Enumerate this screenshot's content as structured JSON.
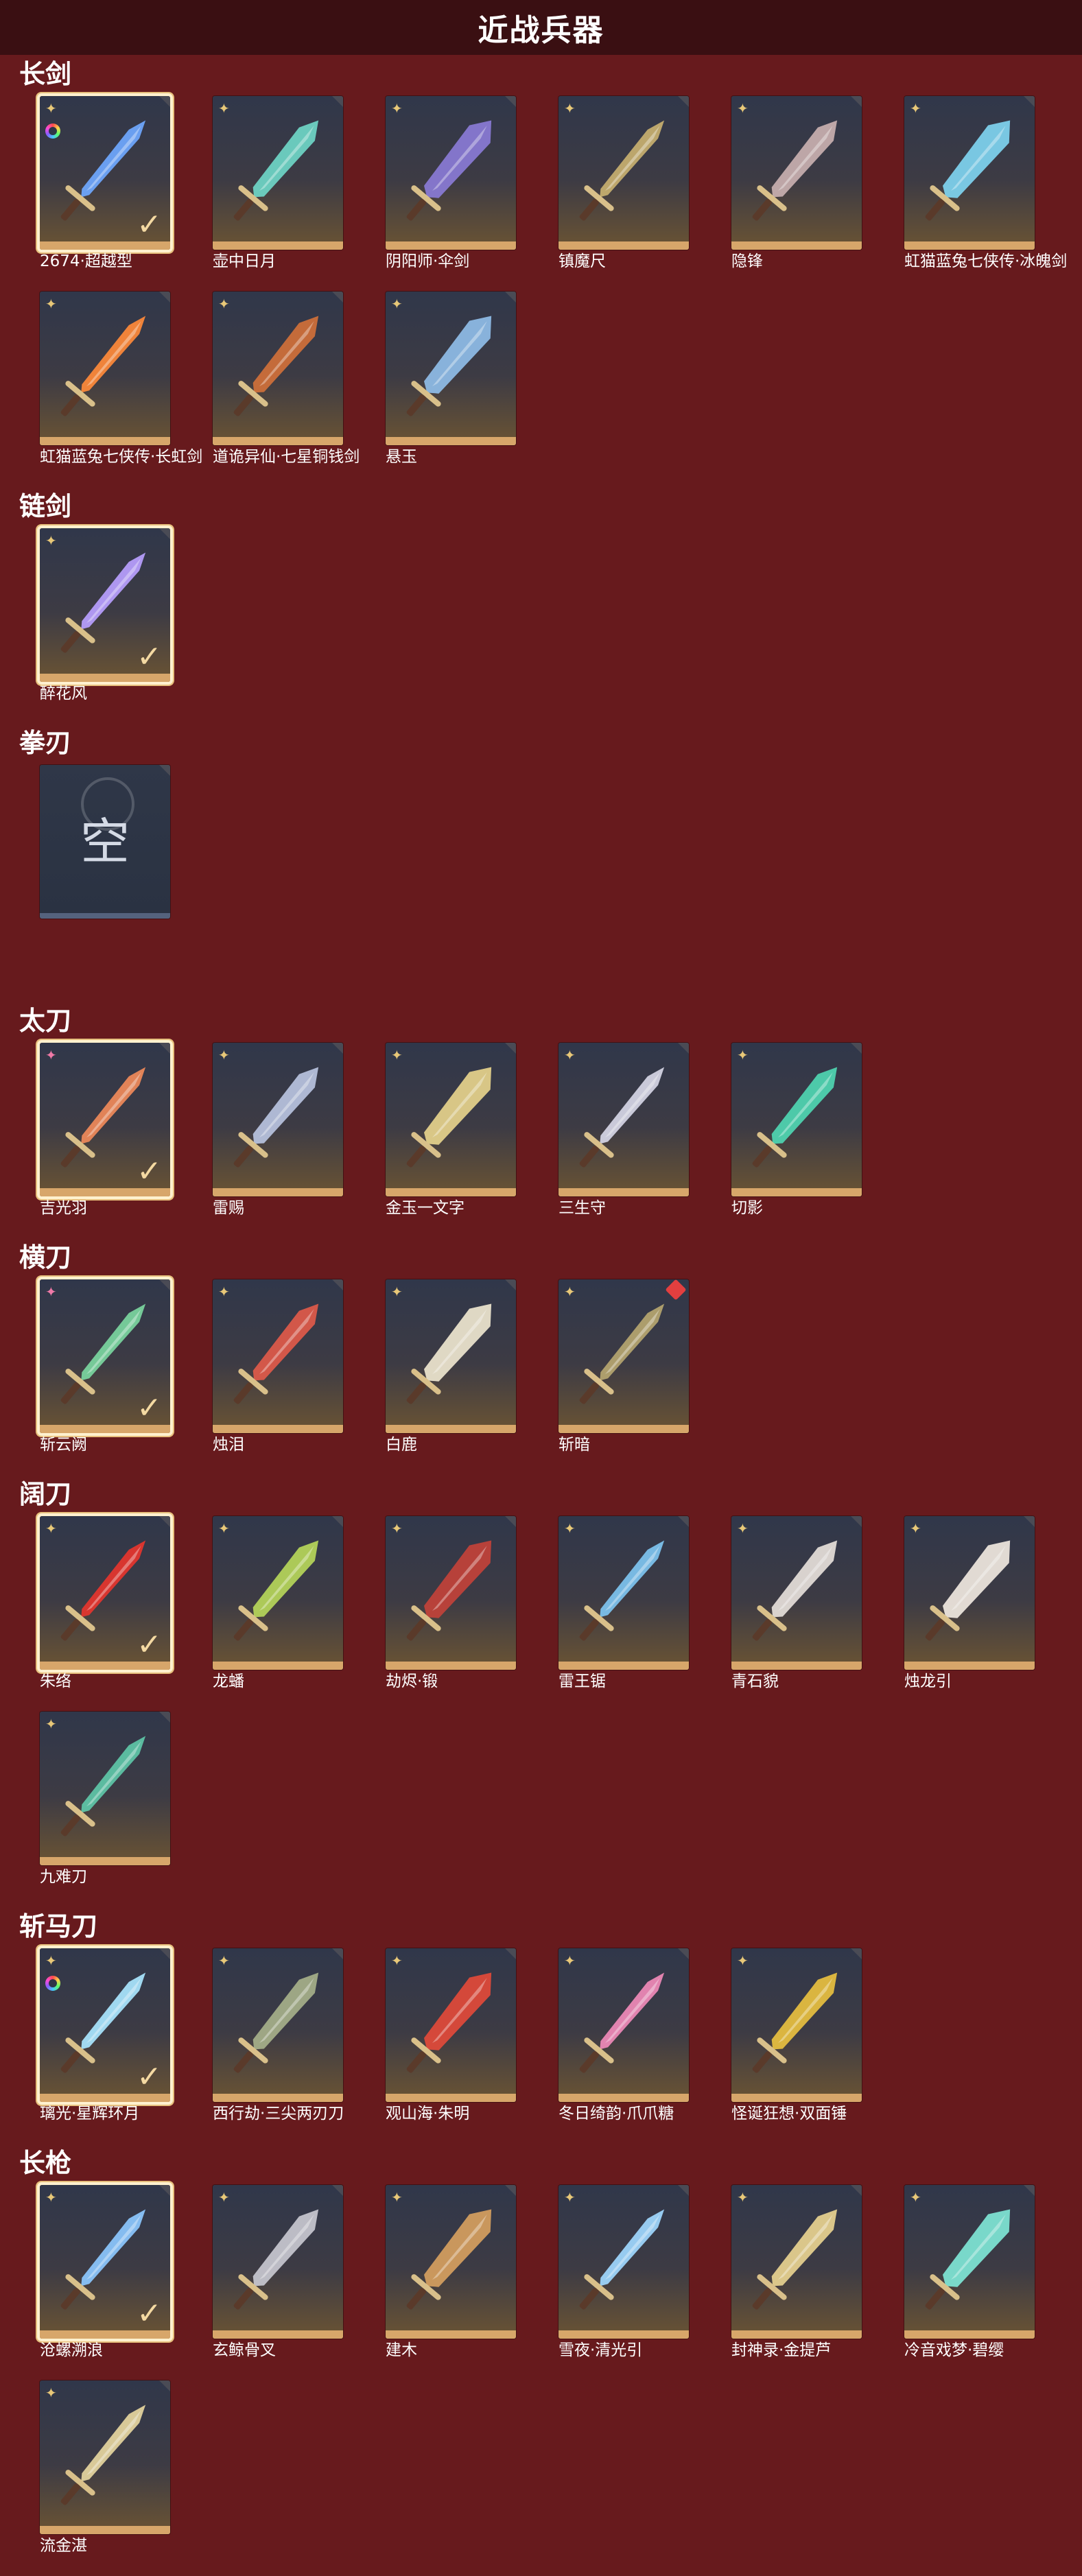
{
  "page": {
    "title": "近战兵器"
  },
  "colors": {
    "background": "#671a1d",
    "header": "#3a0f12",
    "card_base": "#d7a66a",
    "selected_border": "#fff1cf"
  },
  "sections": [
    {
      "title": "长剑",
      "items": [
        {
          "name": "2674·超越型",
          "selected": true,
          "rainbow": true,
          "color": "#6fa8ff"
        },
        {
          "name": "壶中日月",
          "color": "#6fd6c7"
        },
        {
          "name": "阴阳师·伞剑",
          "color": "#8a7bd6"
        },
        {
          "name": "镇魔尺",
          "color": "#c8b070"
        },
        {
          "name": "隐锋",
          "color": "#c9b0b0"
        },
        {
          "name": "虹猫蓝兔七侠传·冰魄剑",
          "color": "#7fd4f0"
        },
        {
          "name": "虹猫蓝兔七侠传·长虹剑",
          "color": "#ff8a3a"
        },
        {
          "name": "道诡异仙·七星铜钱剑",
          "color": "#d0703a"
        },
        {
          "name": "悬玉",
          "color": "#8fbde8"
        }
      ]
    },
    {
      "title": "链剑",
      "items": [
        {
          "name": "醉花风",
          "selected": true,
          "color": "#b8a0ff"
        }
      ]
    },
    {
      "title": "拳刃",
      "items": [
        {
          "name": "",
          "empty": true,
          "empty_text": "空"
        }
      ]
    },
    {
      "title": "太刀",
      "items": [
        {
          "name": "吉光羽",
          "selected": true,
          "pink": true,
          "color": "#f08a5a"
        },
        {
          "name": "雷赐",
          "color": "#b9c3e0"
        },
        {
          "name": "金玉一文字",
          "color": "#e6d28c"
        },
        {
          "name": "三生守",
          "color": "#d6d6e6"
        },
        {
          "name": "切影",
          "color": "#4fd6b2"
        }
      ]
    },
    {
      "title": "横刀",
      "items": [
        {
          "name": "斩云阙",
          "selected": true,
          "pink": true,
          "color": "#7bd6a0"
        },
        {
          "name": "烛泪",
          "color": "#e05a4a"
        },
        {
          "name": "白鹿",
          "color": "#eee6cf"
        },
        {
          "name": "斩暗",
          "red_badge": true,
          "color": "#b6a670"
        }
      ]
    },
    {
      "title": "阔刀",
      "items": [
        {
          "name": "朱络",
          "selected": true,
          "color": "#e6352e"
        },
        {
          "name": "龙蟠",
          "color": "#b6d65a"
        },
        {
          "name": "劫烬·锻",
          "color": "#c2423a"
        },
        {
          "name": "雷王锯",
          "color": "#7ec4f0"
        },
        {
          "name": "青石貌",
          "color": "#e6e0da"
        },
        {
          "name": "烛龙引",
          "color": "#f0e8e0"
        },
        {
          "name": "九难刀",
          "color": "#5ec7a8"
        }
      ]
    },
    {
      "title": "斩马刀",
      "items": [
        {
          "name": "璃光·星辉环月",
          "selected": true,
          "rainbow": true,
          "color": "#a9e6ff"
        },
        {
          "name": "西行劫·三尖两刃刀",
          "color": "#a6b08a"
        },
        {
          "name": "观山海·朱明",
          "color": "#e24a3a"
        },
        {
          "name": "冬日绮韵·爪爪糖",
          "color": "#f08ab8"
        },
        {
          "name": "怪诞狂想·双面锤",
          "color": "#e8c040"
        }
      ]
    },
    {
      "title": "长枪",
      "items": [
        {
          "name": "沧螺溯浪",
          "selected": true,
          "color": "#8cc8ff"
        },
        {
          "name": "玄鲸骨叉",
          "color": "#c8c8d0"
        },
        {
          "name": "建木",
          "color": "#d6a060"
        },
        {
          "name": "雪夜·清光引",
          "color": "#9fd8ff"
        },
        {
          "name": "封神录·金提芦",
          "color": "#e8d290"
        },
        {
          "name": "冷音戏梦·碧缨",
          "color": "#7fe6d6"
        },
        {
          "name": "流金湛",
          "color": "#e6d6a0"
        }
      ]
    }
  ]
}
